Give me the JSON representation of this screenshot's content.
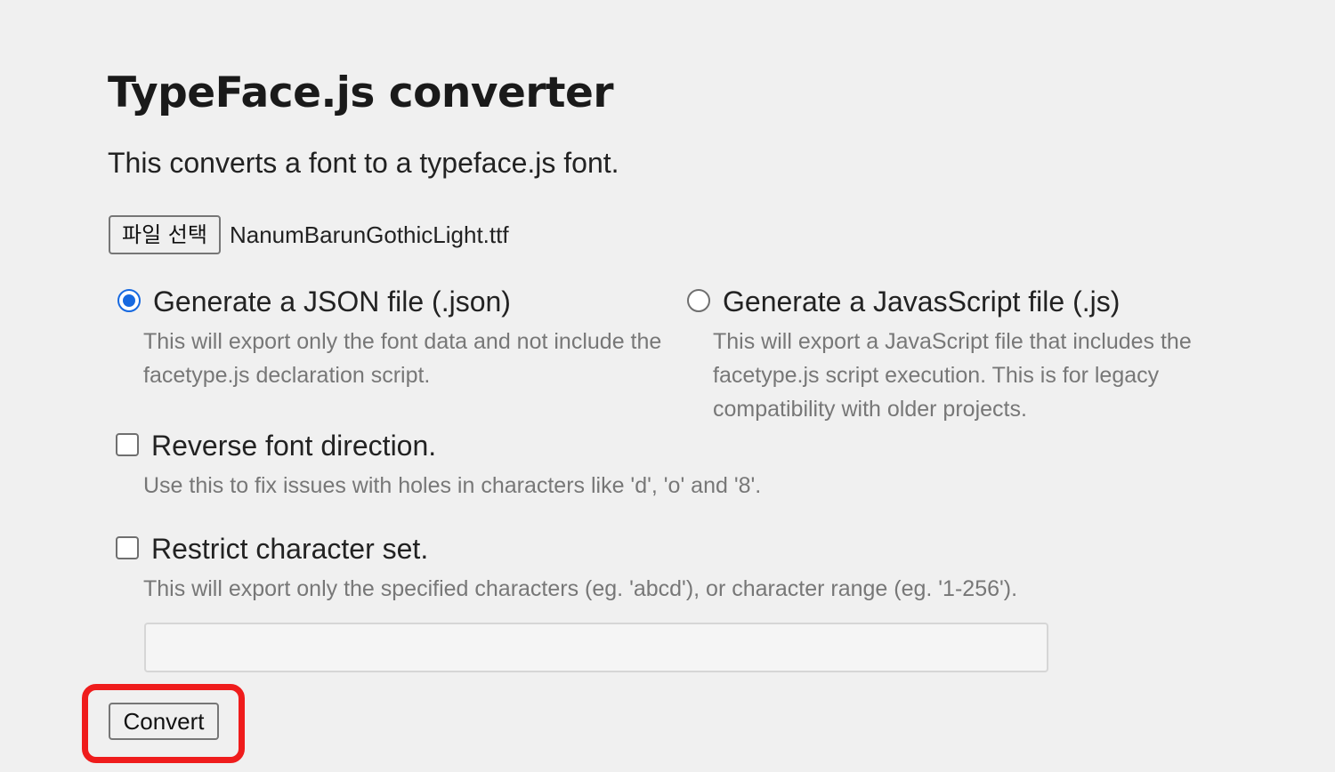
{
  "page": {
    "title": "TypeFace.js converter",
    "subtitle": "This converts a font to a typeface.js font."
  },
  "file_picker": {
    "button_label": "파일 선택",
    "selected_file": "NanumBarunGothicLight.ttf"
  },
  "output_format": {
    "selected": "json",
    "options": [
      {
        "label": "Generate a JSON file (.json)",
        "description": "This will export only the font data and not include the facetype.js declaration script.",
        "checked": true
      },
      {
        "label": "Generate a JavasScript file (.js)",
        "description": "This will export a JavaScript file that includes the facetype.js script execution. This is for legacy compatibility with older projects.",
        "checked": false
      }
    ]
  },
  "reverse_direction": {
    "label": "Reverse font direction.",
    "description": "Use this to fix issues with holes in characters like 'd', 'o' and '8'.",
    "checked": false
  },
  "restrict_charset": {
    "label": "Restrict character set.",
    "description": "This will export only the specified characters (eg. 'abcd'), or character range (eg. '1-256').",
    "checked": false,
    "input_value": "",
    "input_placeholder": ""
  },
  "convert_button": {
    "label": "Convert"
  },
  "colors": {
    "background": "#f0f0f0",
    "radio_accent": "#1769e0",
    "highlight_annotation": "#ef1c1c",
    "description_text": "#777777"
  },
  "icons": {
    "radio_checked": "radio-checked-icon",
    "radio_unchecked": "radio-unchecked-icon",
    "checkbox_unchecked": "checkbox-unchecked-icon"
  }
}
